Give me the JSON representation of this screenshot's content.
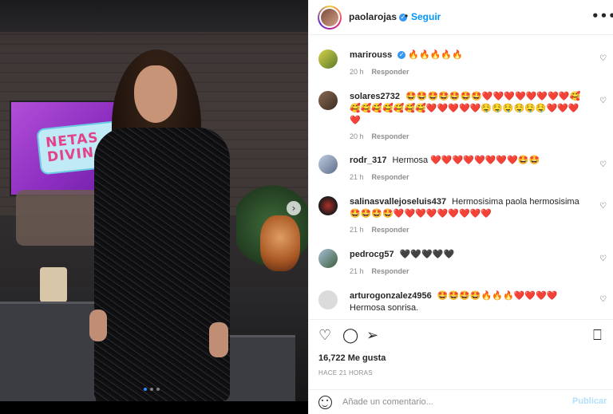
{
  "post": {
    "username": "paolarojas",
    "follow_label": "Seguir",
    "separator": "•",
    "more_label": "•••",
    "carousel": {
      "total": 3,
      "active": 0
    }
  },
  "image_overlay": {
    "tv_logo": "NETAS\nDIVINAS",
    "next_label": "›"
  },
  "comments": [
    {
      "username": "marirouss",
      "verified": true,
      "text": "🔥🔥🔥🔥🔥",
      "time": "20 h",
      "reply": "Responder"
    },
    {
      "username": "solares2732",
      "verified": false,
      "text": "🤩🤩🤩🤩🤩🤩🤩❤️❤️❤️❤️❤️❤️❤️❤️🥰🥰🥰🥰🥰🥰🥰🥰❤️❤️❤️❤️❤️🤤🤤🤤🤤🤤🤤❤️❤️❤️❤️",
      "time": "20 h",
      "reply": "Responder"
    },
    {
      "username": "rodr_317",
      "verified": false,
      "text": "Hermosa ❤️❤️❤️❤️❤️❤️❤️❤️🤩🤩",
      "time": "21 h",
      "reply": "Responder"
    },
    {
      "username": "salinasvallejoseluis437",
      "verified": false,
      "text": "Hermosisima paola hermosisima 🤩🤩🤩🤩❤️❤️❤️❤️❤️❤️❤️❤️❤️",
      "time": "21 h",
      "reply": "Responder"
    },
    {
      "username": "pedrocg57",
      "verified": false,
      "text": "🖤🖤🖤🖤🖤",
      "time": "21 h",
      "reply": "Responder"
    },
    {
      "username": "arturogonzalez4956",
      "verified": false,
      "text": "🤩🤩🤩🤩🔥🔥🔥❤️❤️❤️❤️ Hermosa sonrisa.",
      "time": "",
      "reply": ""
    }
  ],
  "actions": {
    "like_icon": "heart-outline-icon",
    "comment_icon": "speech-bubble-icon",
    "share_icon": "paper-plane-icon",
    "save_icon": "bookmark-icon",
    "likes": "16,722 Me gusta",
    "time_ago": "HACE 21 HORAS"
  },
  "composer": {
    "placeholder": "Añade un comentario...",
    "post_label": "Publicar"
  },
  "colors": {
    "link_blue": "#0095f6",
    "post_disabled": "#b2dffc",
    "muted": "#8e8e8e"
  }
}
